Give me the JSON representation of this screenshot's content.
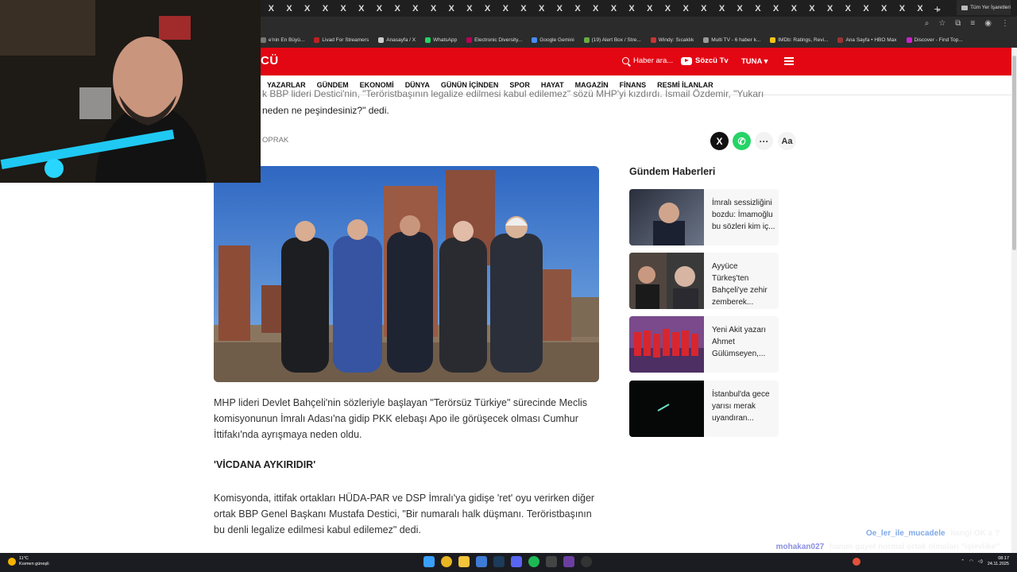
{
  "browser": {
    "tab_glyph": "X",
    "tab_count": 37,
    "new_tab": "+",
    "window_controls": [
      "⌄",
      "—",
      "❐",
      "✕"
    ],
    "addr_icons": [
      "⌕",
      "☆",
      "⧉",
      "≡",
      "◉",
      "⋮"
    ],
    "bookmarks": [
      "e'nin En Büyü...",
      "Livad For Streamers",
      "Anasayfa / X",
      "WhatsApp",
      "Electronic Diversity...",
      "Google Gemini",
      "(19) Alert Box / Stre...",
      "Windy: Sıcaklık",
      "Multi TV - 6 haber k...",
      "IMDb: Ratings, Revi...",
      "Ana Sayfa • HBO Max",
      "Discover - Find Top..."
    ],
    "all_bookmarks": "Tüm Yer İşaretleri"
  },
  "site": {
    "logo": "CÜ",
    "search_placeholder": "Haber ara...",
    "tv_label": "Sözcü Tv",
    "user_label": "TUNA ▾",
    "nav": [
      "YAZARLAR",
      "GÜNDEM",
      "EKONOMİ",
      "DÜNYA",
      "GÜNÜN İÇİNDEN",
      "SPOR",
      "HAYAT",
      "MAGAZİN",
      "FİNANS",
      "RESMİ İLANLAR"
    ]
  },
  "article": {
    "intro_line1": "k BBP lideri Destici'nin, \"Teröristbaşının legalize edilmesi kabul edilemez\" sözü MHP'yi kızdırdı. İsmail Özdemir, \"Yukarı",
    "intro_line2": "neden ne peşindesiniz?\" dedi.",
    "author": "OPRAK",
    "share_x": "X",
    "share_whatsapp": "✆",
    "share_more": "···",
    "font_size": "Aa",
    "paragraph1": "MHP lideri Devlet Bahçeli'nin sözleriyle başlayan \"Terörsüz Türkiye\" sürecinde Meclis komisyonunun İmralı Adası'na gidip PKK elebaşı Apo ile görüşecek olması Cumhur İttifakı'nda ayrışmaya neden oldu.",
    "subheading": "'VİCDANA AYKIRIDIR'",
    "paragraph2": "Komisyonda, ittifak ortakları HÜDA-PAR ve DSP İmralı'ya gidişe 'ret' oyu verirken diğer ortak BBP Genel Başkanı Mustafa Destici, \"Bir numaralı halk düşmanı. Teröristbaşının bu denli legalize edilmesi kabul edilemez\" dedi."
  },
  "sidebar": {
    "title": "Gündem Haberleri",
    "items": [
      {
        "text": "İmralı sessizliğini bozdu: İmamoğlu bu sözleri kim iç..."
      },
      {
        "text": "Ayyüce Türkeş'ten Bahçeli'ye zehir zemberek..."
      },
      {
        "text": "Yeni Akit yazarı Ahmet Gülümseyen,..."
      },
      {
        "text": "İstanbul'da gece yarısı merak uyandıran..."
      }
    ]
  },
  "chat": [
    {
      "user": "Oe_ler_ile_mucadele",
      "message": "hangi OK a ?",
      "color": "#7fa8e8"
    },
    {
      "user": "mohakan027",
      "message": "hanım gayet normal ortak olmaları \"işlevlike\"",
      "color": "#8a8fe0"
    }
  ],
  "taskbar": {
    "temp": "11°C",
    "weather": "Kısmen güneşli",
    "time": "08:17",
    "date": "24.11.2025"
  },
  "colors": {
    "brand": "#e30613",
    "whatsapp": "#25d366"
  }
}
